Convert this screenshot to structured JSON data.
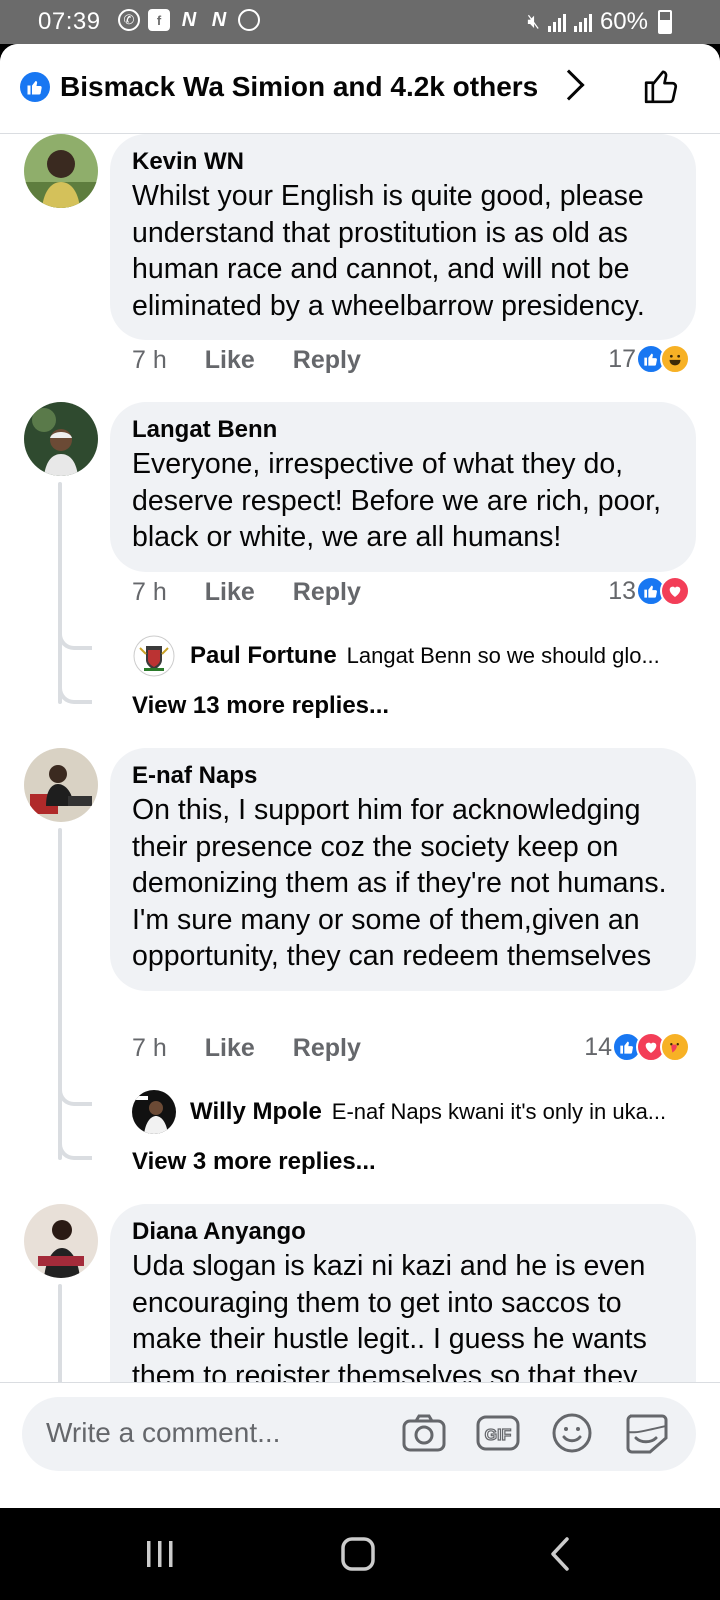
{
  "status_bar": {
    "time": "07:39",
    "left_icons": [
      "whatsapp-icon",
      "facebook-icon",
      "n-icon",
      "n-icon",
      "o-icon"
    ],
    "battery": "60%"
  },
  "header": {
    "reactors": "Bismack Wa Simion and 4.2k others"
  },
  "comments": [
    {
      "author": "Kevin WN",
      "text": "Whilst your English is quite good, please understand that prostitution is as old as human race and cannot, and will not be eliminated by a wheelbarrow presidency.",
      "time": "7 h",
      "like": "Like",
      "reply": "Reply",
      "reaction_count": "17",
      "reactions": [
        "like",
        "haha"
      ]
    },
    {
      "author": "Langat Benn",
      "text": "Everyone, irrespective of what they do, deserve respect! Before we are rich, poor, black or white, we are all humans!",
      "time": "7 h",
      "like": "Like",
      "reply": "Reply",
      "reaction_count": "13",
      "reactions": [
        "like",
        "love"
      ],
      "top_reply": {
        "author": "Paul Fortune",
        "text": "Langat Benn  so we should glo..."
      },
      "view_more": "View 13 more replies..."
    },
    {
      "author": "E-naf Naps",
      "text": "On this, I support him for acknowledging their presence coz the society keep on demonizing them as if they're not humans. I'm sure many or some of them,given an opportunity, they can redeem themselves",
      "time": "7 h",
      "like": "Like",
      "reply": "Reply",
      "reaction_count": "14",
      "reactions": [
        "like",
        "love",
        "care"
      ],
      "top_reply": {
        "author": "Willy Mpole",
        "text": "E-naf Naps kwani it's only in uka..."
      },
      "view_more": "View 3 more replies..."
    },
    {
      "author": "Diana Anyango",
      "text": "Uda slogan is kazi ni kazi and he is even encouraging them to get into saccos to make their hustle legit.. I guess he wants them to register themselves so that they"
    }
  ],
  "composer": {
    "placeholder": "Write a comment..."
  },
  "colors": {
    "facebook_blue": "#1877f2",
    "bubble_bg": "#f0f2f5",
    "secondary_text": "#65676b",
    "love_red": "#f33e58",
    "haha_yellow": "#f7b125"
  }
}
